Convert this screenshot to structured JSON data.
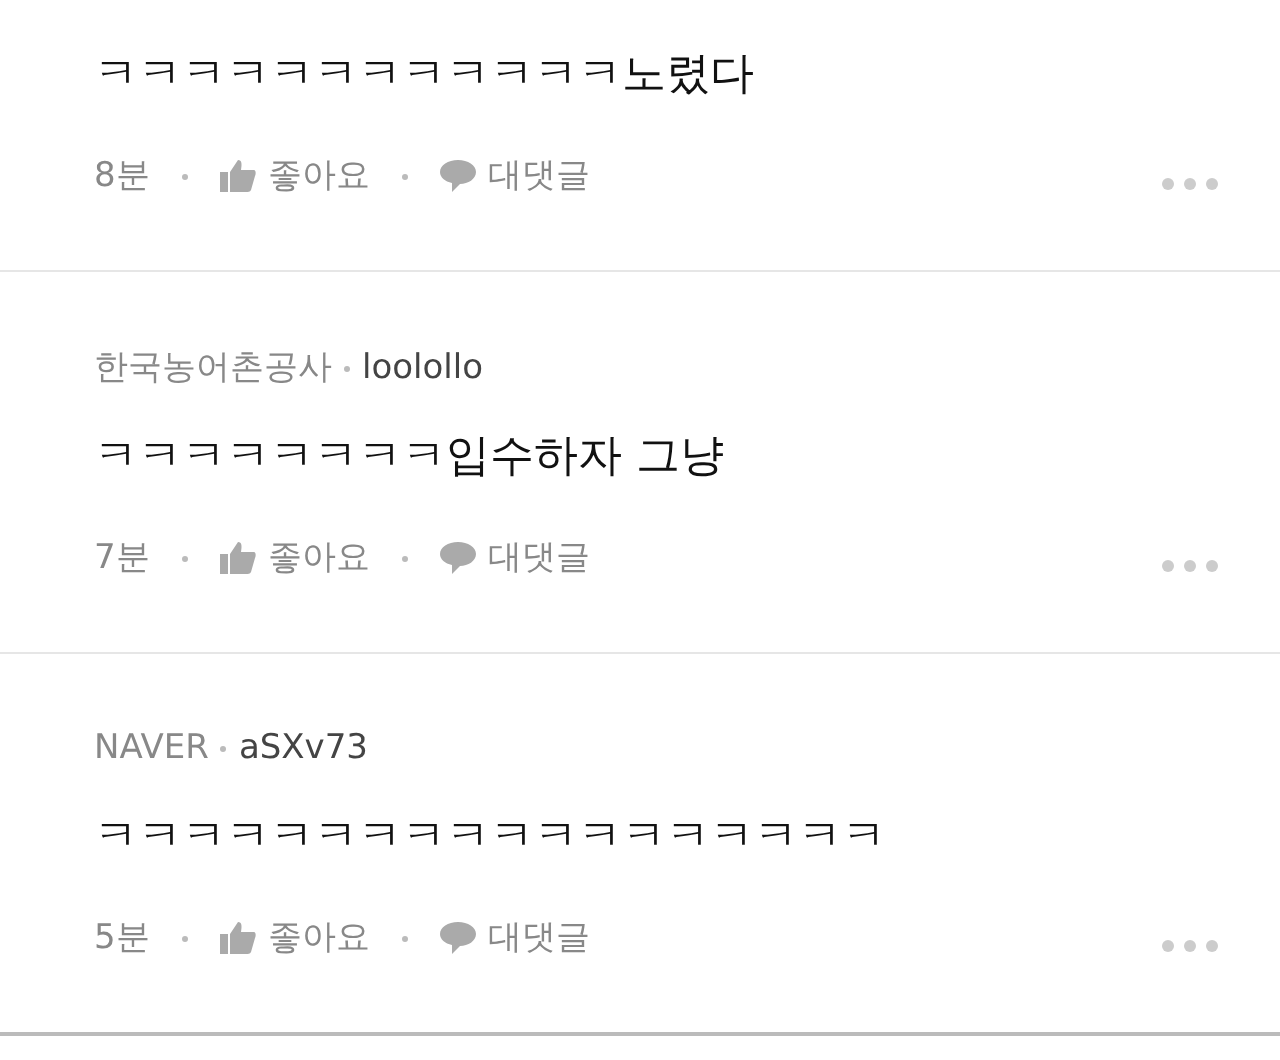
{
  "comments": [
    {
      "text": "ㅋㅋㅋㅋㅋㅋㅋㅋㅋㅋㅋㅋ노렸다",
      "time": "8분",
      "like_label": "좋아요",
      "reply_label": "대댓글"
    },
    {
      "source": "한국농어촌공사",
      "author": "loolollo",
      "text": "ㅋㅋㅋㅋㅋㅋㅋㅋ입수하자 그냥",
      "time": "7분",
      "like_label": "좋아요",
      "reply_label": "대댓글"
    },
    {
      "source": "NAVER",
      "author": "aSXv73",
      "text": "ㅋㅋㅋㅋㅋㅋㅋㅋㅋㅋㅋㅋㅋㅋㅋㅋㅋㅋ",
      "time": "5분",
      "like_label": "좋아요",
      "reply_label": "대댓글"
    }
  ]
}
